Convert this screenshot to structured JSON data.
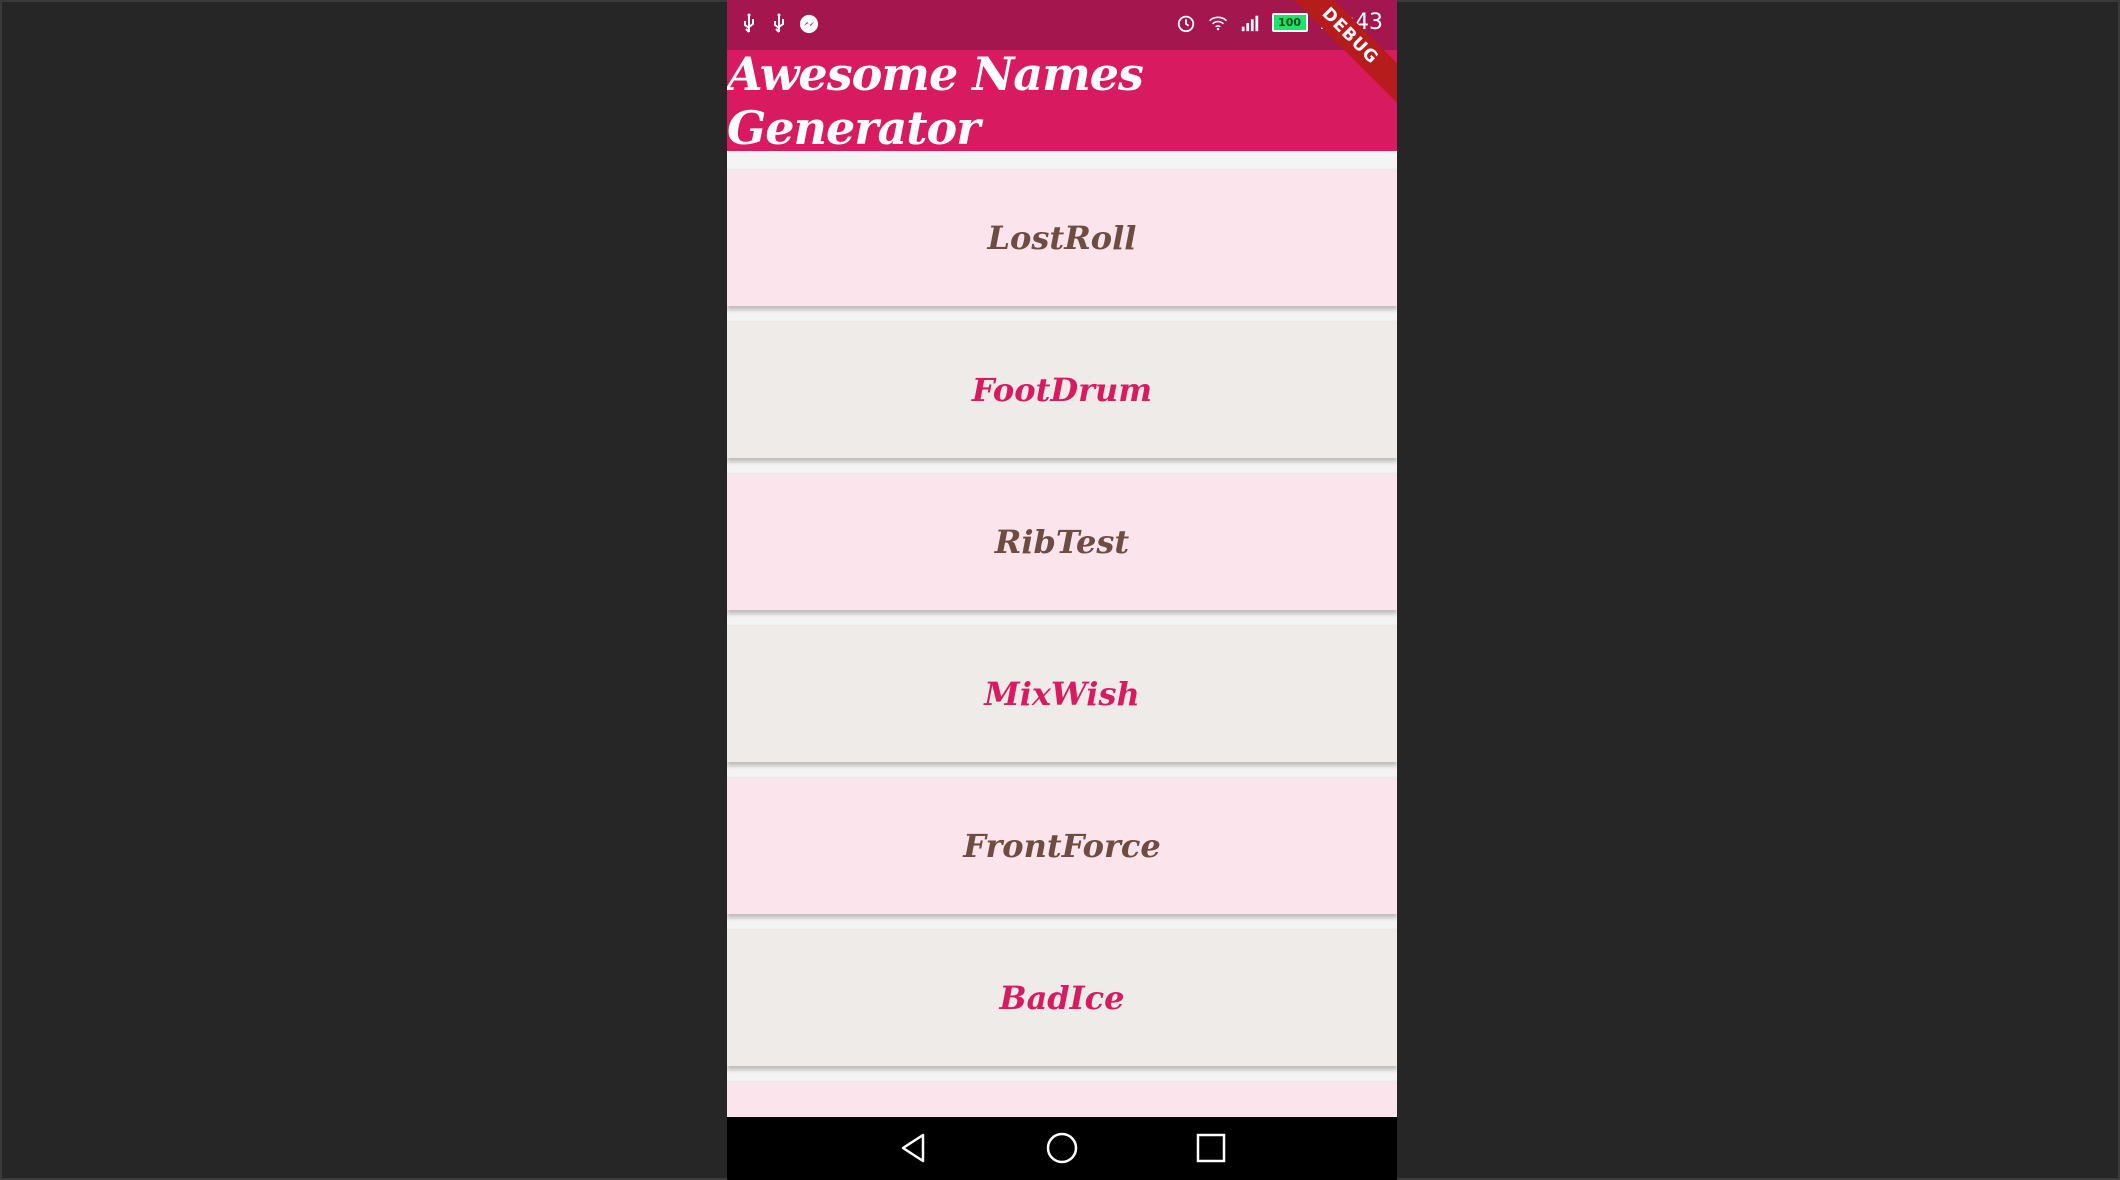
{
  "status_bar": {
    "left_icons": [
      "usb-icon",
      "usb-icon",
      "messenger-icon"
    ],
    "right_icons": [
      "alarm-icon",
      "wifi-icon",
      "signal-icon"
    ],
    "battery_level": "100",
    "time": "20:43"
  },
  "app_bar": {
    "title": "Awesome Names Generator",
    "debug_label": "DEBUG"
  },
  "list": {
    "items": [
      {
        "name": "LostRoll",
        "style": "pink"
      },
      {
        "name": "FootDrum",
        "style": "grey"
      },
      {
        "name": "RibTest",
        "style": "pink"
      },
      {
        "name": "MixWish",
        "style": "grey"
      },
      {
        "name": "FrontForce",
        "style": "pink"
      },
      {
        "name": "BadIce",
        "style": "grey"
      },
      {
        "name": "",
        "style": "pink"
      }
    ]
  },
  "nav_bar": {
    "buttons": [
      "back-icon",
      "home-icon",
      "recents-icon"
    ]
  },
  "colors": {
    "primary": "#d81b60",
    "status_bar": "#a3174e",
    "card_pink": "#fce4ec",
    "card_grey": "#efebe9",
    "text_brown": "#6d4c41",
    "text_pink": "#d81b60",
    "background": "#262626"
  }
}
